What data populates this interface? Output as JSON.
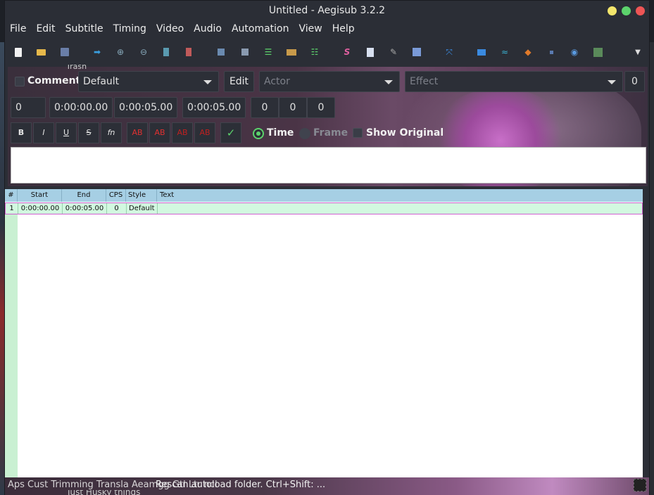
{
  "window": {
    "title": "Untitled - Aegisub 3.2.2",
    "controls": {
      "minimize_color": "#f4e66c",
      "maximize_color": "#5cd36c",
      "close_color": "#ee5555"
    }
  },
  "menu": [
    "File",
    "Edit",
    "Subtitle",
    "Timing",
    "Video",
    "Audio",
    "Automation",
    "View",
    "Help"
  ],
  "toolbar": {
    "icons": [
      "new-file-icon",
      "open-file-icon",
      "save-icon",
      "jump-to-icon",
      "zoom-in-icon",
      "zoom-out-icon",
      "snap-start-icon",
      "snap-end-icon",
      "set-start-icon",
      "set-end-icon",
      "grid-icon",
      "film-icon",
      "list-icon",
      "styles-manager-icon",
      "properties-icon",
      "attachments-icon",
      "fonts-collector-icon",
      "resample-icon",
      "timing-post-processor-icon",
      "kanji-timer-icon",
      "shift-times-icon",
      "fish-icon",
      "select-lines-icon",
      "options-icon",
      "hotkeys-icon",
      "overflow-chevron-icon"
    ]
  },
  "edit": {
    "comment_label": "Comment",
    "style_value": "Default",
    "edit_button": "Edit",
    "actor_placeholder": "Actor",
    "effect_placeholder": "Effect",
    "effect_count": "0",
    "layer": "0",
    "start_time": "0:00:00.00",
    "end_time": "0:00:05.00",
    "duration": "0:00:05.00",
    "margin_left": "0",
    "margin_right": "0",
    "margin_vertical": "0",
    "format_buttons": [
      "B",
      "I",
      "U",
      "S",
      "fn"
    ],
    "color_buttons": [
      "AB",
      "AB",
      "AB",
      "AB"
    ],
    "commit_icon": "✓",
    "time_label": "Time",
    "frame_label": "Frame",
    "show_original_label": "Show Original",
    "text_value": ""
  },
  "grid": {
    "headers": [
      "#",
      "Start",
      "End",
      "CPS",
      "Style",
      "Text"
    ],
    "rows": [
      {
        "num": "1",
        "start": "0:00:00.00",
        "end": "0:00:05.00",
        "cps": "0",
        "style": "Default",
        "text": ""
      }
    ]
  },
  "status": {
    "text": "Rescan autoload folder. Ctrl+Shift: ...",
    "overlay_text": "Aps Cust Trimming Transla Aeamgg Gtl Ltr ncl"
  },
  "desktop": {
    "bottom_text": "Just Husky things",
    "top_text": "Trash"
  }
}
